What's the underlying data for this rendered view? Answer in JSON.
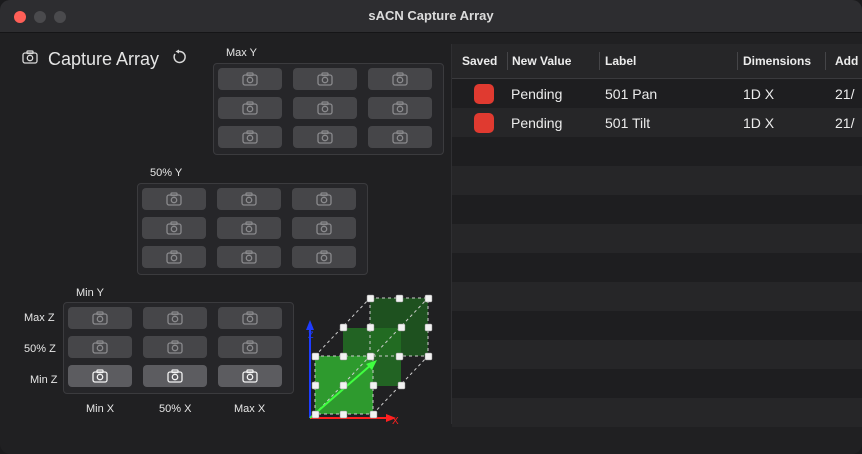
{
  "window": {
    "title": "sACN Capture Array"
  },
  "capture": {
    "title": "Capture Array",
    "icon": "camera-icon",
    "reset_icon": "reset-icon"
  },
  "labels": {
    "max_y": "Max Y",
    "mid_y": "50% Y",
    "min_y": "Min Y",
    "z_rows": [
      "Max Z",
      "50% Z",
      "Min Z"
    ],
    "x_cols": [
      "Min X",
      "50% X",
      "Max X"
    ]
  },
  "table": {
    "columns": [
      "Saved",
      "New Value",
      "Label",
      "Dimensions",
      "Add"
    ],
    "rows": [
      {
        "saved": "red",
        "value": "Pending",
        "label": "501 Pan",
        "dimensions": "1D X",
        "add": "21/"
      },
      {
        "saved": "red",
        "value": "Pending",
        "label": "501 Tilt",
        "dimensions": "1D X",
        "add": "21/"
      }
    ]
  },
  "colors": {
    "accent_red": "#e03a30",
    "cube_green": "#2e9a2e",
    "axis_blue": "#1e3cff",
    "axis_red": "#ff2020"
  }
}
